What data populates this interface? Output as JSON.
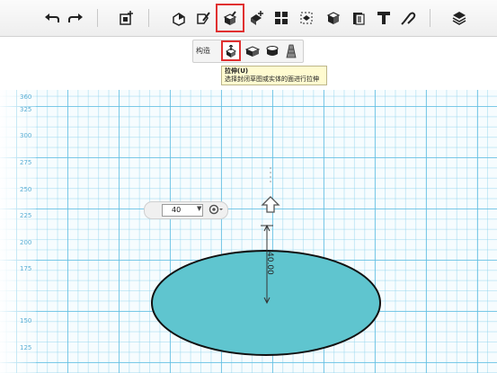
{
  "toolbar": {
    "icons": [
      "undo-icon",
      "redo-icon",
      "primitives-icon",
      "sketch-icon",
      "construct-icon",
      "modify-icon",
      "pattern-icon",
      "group-icon",
      "combine-icon",
      "measure-icon",
      "text-icon",
      "snap-icon",
      "material-icon"
    ],
    "selected": "construct-icon"
  },
  "construct_menu": {
    "label": "构造",
    "items": [
      "extrude-icon",
      "sweep-icon",
      "revolve-icon",
      "loft-icon"
    ],
    "selected": "extrude-icon"
  },
  "tooltip": {
    "title": "拉伸(U)",
    "description": "选择封闭草图或实体的面进行拉伸"
  },
  "grid": {
    "axis_labels": [
      "360",
      "325",
      "300",
      "275",
      "250",
      "225",
      "200",
      "175",
      "150",
      "125"
    ]
  },
  "extrude_box": {
    "value": "40"
  },
  "dimension": {
    "text": "40.00"
  },
  "colors": {
    "accent": "#e03030",
    "shape_fill": "#5fc5cf",
    "grid": "#60bee2"
  }
}
